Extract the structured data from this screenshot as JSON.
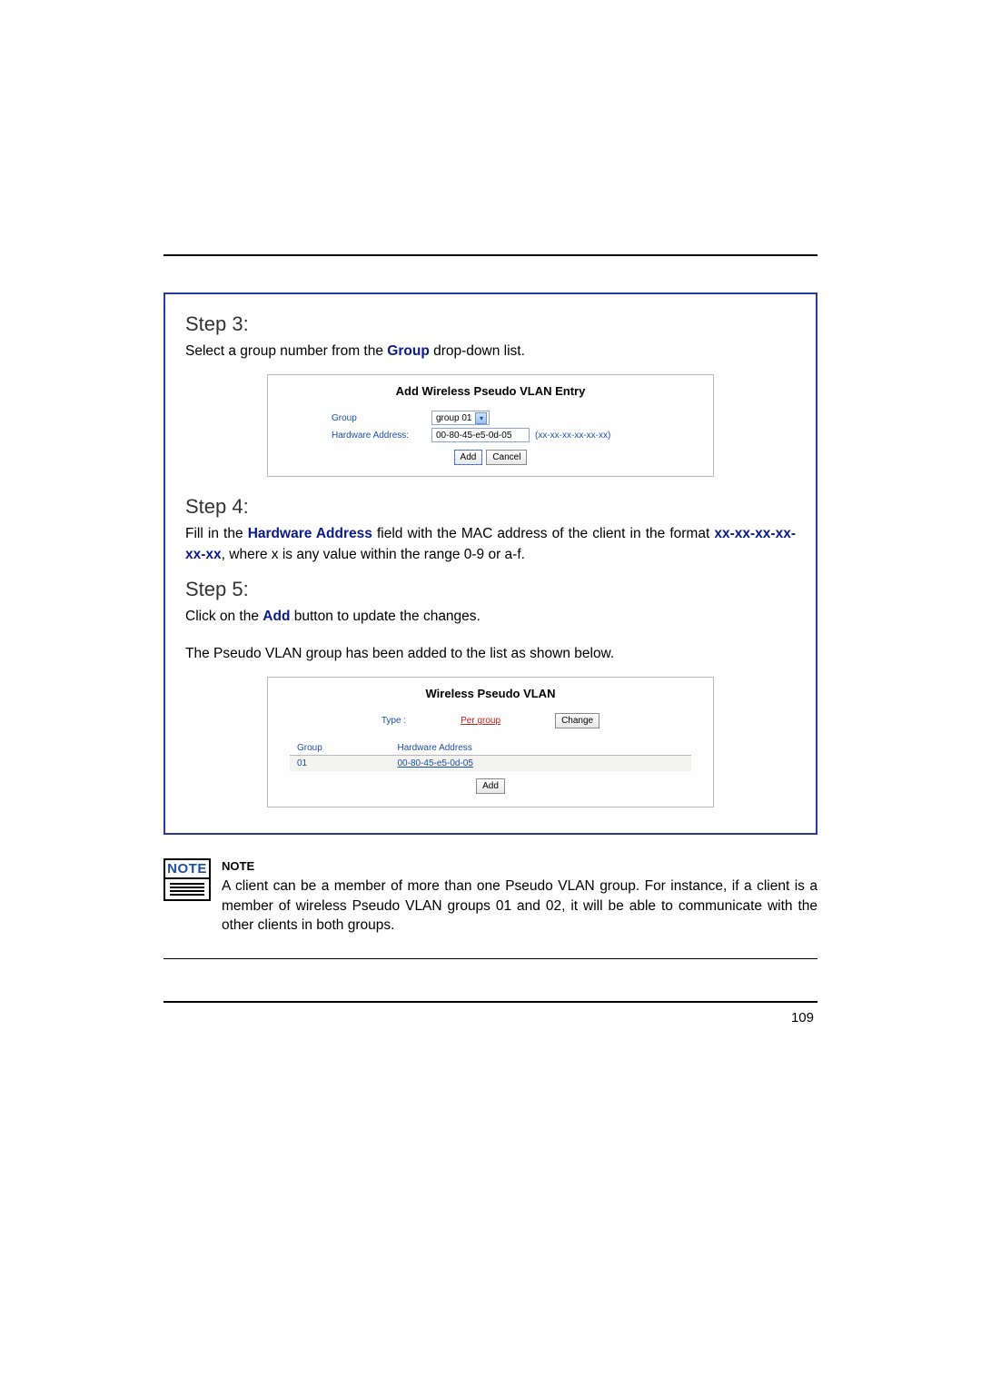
{
  "step3": {
    "heading": "Step 3:",
    "text_pre": "Select a group number from the ",
    "text_bold": "Group",
    "text_post": " drop-down list."
  },
  "panel1": {
    "title": "Add Wireless Pseudo VLAN Entry",
    "group_label": "Group",
    "group_value": "group 01",
    "hw_label": "Hardware Address:",
    "hw_value": "00-80-45-e5-0d-05",
    "hw_hint": "(xx-xx-xx-xx-xx-xx)",
    "add_btn": "Add",
    "cancel_btn": "Cancel"
  },
  "step4": {
    "heading": "Step 4:",
    "seg1": "Fill in the ",
    "bold1": "Hardware Address",
    "seg2": " field with the MAC address of the client in the format ",
    "bold2": "xx-xx-xx-xx-xx-xx",
    "seg3": ", where x is any value within the range 0-9 or a-f."
  },
  "step5": {
    "heading": "Step 5:",
    "seg1": "Click on the ",
    "bold1": "Add",
    "seg2": " button to update the changes.",
    "result": "The Pseudo VLAN group has been added to the list as shown below."
  },
  "panel2": {
    "title": "Wireless Pseudo VLAN",
    "type_label": "Type :",
    "type_value": "Per group",
    "change_btn": "Change",
    "col_group": "Group",
    "col_hw": "Hardware Address",
    "row_group": "01",
    "row_hw": "00-80-45-e5-0d-05",
    "add_btn": "Add"
  },
  "note": {
    "icon_label": "NOTE",
    "heading": "NOTE",
    "body": "A client can be a member of more than one Pseudo VLAN group. For instance, if a client is a member of wireless Pseudo VLAN groups 01 and 02, it will be able to communicate with the other clients in both groups."
  },
  "page_number": "109"
}
